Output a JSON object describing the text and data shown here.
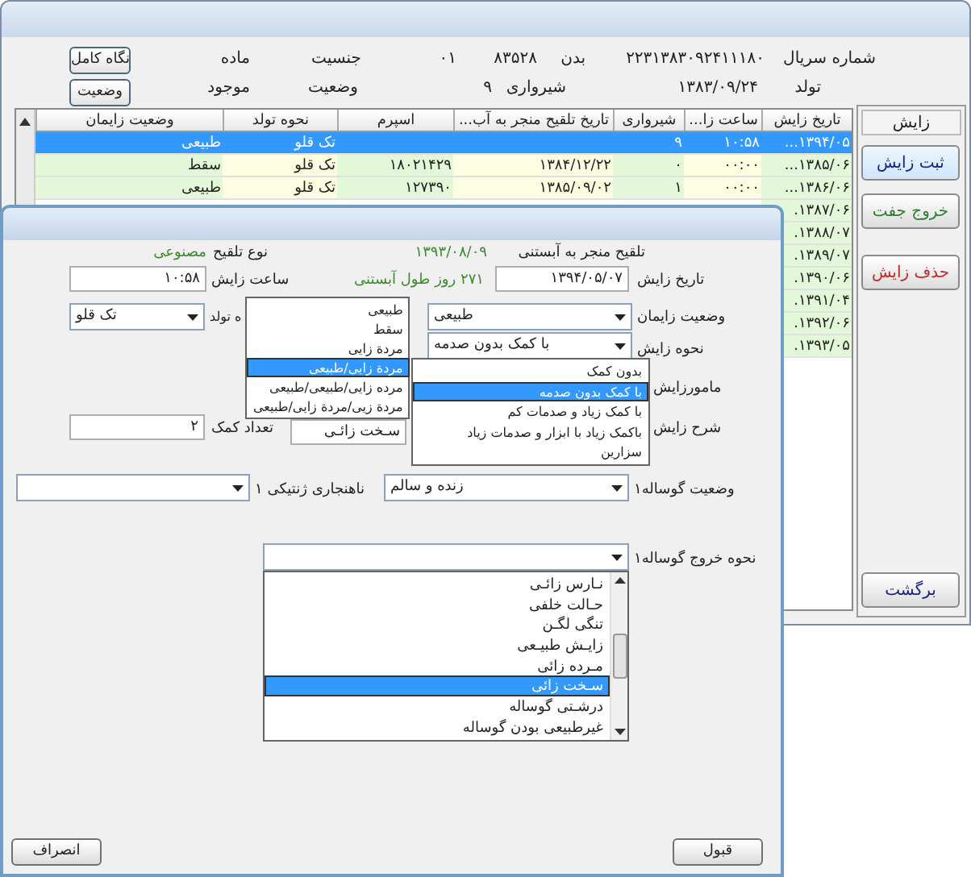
{
  "main_window": {
    "header": [
      {
        "label": "شماره سریال",
        "values": [
          "۲۲۳۱۳۸۳۰۹۲۴۱۱۱۸۰"
        ]
      },
      {
        "label": "بدن",
        "values": [
          "۸۳۵۲۸",
          "۰۱"
        ]
      },
      {
        "label": "جنسیت",
        "values": [
          "ماده"
        ]
      },
      {
        "label": "تولد",
        "values": [
          "۱۳۸۳/۰۹/۲۴"
        ]
      },
      {
        "label": "شیرواری",
        "values": [
          "۹"
        ]
      },
      {
        "label": "وضعیت",
        "values": [
          "موجود"
        ]
      }
    ],
    "header_buttons": [
      "نگاه کامل",
      "وضعیت"
    ],
    "table": {
      "columns": [
        "تاریخ زایش",
        "ساعت زا...",
        "شیرواری",
        "تاریخ تلقیح منجر به آب...",
        "اسپرم",
        "نحوه تولد",
        "وضعیت زایمان"
      ],
      "rows": [
        {
          "cells": [
            "۱۳۹۴/۰۵...",
            "۱۰:۵۸",
            "۹",
            "",
            "",
            "تک قلو",
            "طبیعی"
          ],
          "selected": true
        },
        {
          "cells": [
            "۱۳۸۵/۰۶...",
            "۰۰:۰۰",
            "۰",
            "۱۳۸۴/۱۲/۲۲",
            "۱۸۰۲۱۴۲۹",
            "تک قلو",
            "سقط"
          ],
          "selected": false
        },
        {
          "cells": [
            "۱۳۸۶/۰۶...",
            "۰۰:۰۰",
            "۱",
            "۱۳۸۵/۰۹/۰۲",
            "۱۲۷۳۹۰",
            "تک قلو",
            "طبیعی"
          ],
          "selected": false
        },
        {
          "cells": [
            "۱۳۸۷/۰۶."
          ],
          "selected": false
        },
        {
          "cells": [
            "۱۳۸۸/۰۷."
          ],
          "selected": false
        },
        {
          "cells": [
            "۱۳۸۹/۰۷."
          ],
          "selected": false
        },
        {
          "cells": [
            "۱۳۹۰/۰۶."
          ],
          "selected": false
        },
        {
          "cells": [
            "۱۳۹۱/۰۴."
          ],
          "selected": false
        },
        {
          "cells": [
            "۱۳۹۲/۰۶."
          ],
          "selected": false
        },
        {
          "cells": [
            "۱۳۹۳/۰۵."
          ],
          "selected": false
        }
      ]
    },
    "side_panel": {
      "title": "زایش",
      "buttons": [
        {
          "label": "ثبت زایش",
          "color": "#1a237e"
        },
        {
          "label": "خروج جفت",
          "color": "#2e7d32"
        },
        {
          "label": "حذف زایش",
          "color": "#c62828"
        },
        {
          "label": "برگشت",
          "color": "#1a237e"
        }
      ]
    }
  },
  "dialog": {
    "info": [
      {
        "kind": "label",
        "text": "تلقیح منجر به آبستنی"
      },
      {
        "kind": "value",
        "text": "۱۳۹۳/۰۸/۰۹"
      },
      {
        "kind": "label",
        "text": "نوع تلقیح"
      },
      {
        "kind": "value",
        "text": "مصنوعی"
      },
      {
        "kind": "value",
        "text": "۲۷۱ روز طول آبستنی"
      }
    ],
    "fields": [
      {
        "kind": "text",
        "label": "تاریخ زایش",
        "value": "۱۳۹۴/۰۵/۰۷"
      },
      {
        "kind": "text",
        "label": "ساعت زایش",
        "value": "۱۰:۵۸"
      },
      {
        "kind": "combo",
        "label": "وضعیت زایمان",
        "value": "طبیعی"
      },
      {
        "kind": "combo",
        "label": "ه تولد",
        "value": "تک قلو"
      },
      {
        "kind": "combo",
        "label": "نحوه زایش",
        "value": "با کمک بدون صدمه"
      },
      {
        "kind": "label",
        "label": "مامورزایش"
      },
      {
        "kind": "label",
        "label": "شرح زایش"
      },
      {
        "kind": "text",
        "value": "سـخت زائـی"
      },
      {
        "kind": "text",
        "label": "تعداد کمک",
        "value": "۲"
      },
      {
        "kind": "combo",
        "label": "وضعیت گوساله۱",
        "value": "زنده و سالم"
      },
      {
        "kind": "combo",
        "label": "ناهنجاری ژنتیکی ۱"
      },
      {
        "kind": "combo",
        "label": "نحوه خروج گوساله۱"
      }
    ],
    "open_lists": [
      {
        "items": [
          {
            "text": "طبیعی",
            "selected": false
          },
          {
            "text": "سقط",
            "selected": false
          },
          {
            "text": "مردة زایی",
            "selected": false
          },
          {
            "text": "مردة زایی/طبیعی",
            "selected": true
          },
          {
            "text": "مرده زایی/طبیعی/طبیعی",
            "selected": false
          },
          {
            "text": "مردة زیی/مردة زایی/طبیعی",
            "selected": false
          }
        ]
      },
      {
        "items": [
          {
            "text": "بدون کمک",
            "selected": false
          },
          {
            "text": "با کمک بدون صدمه",
            "selected": true
          },
          {
            "text": "با کمک زیاد و صدمات کم",
            "selected": false
          },
          {
            "text": "باکمک زیاد با ابزار و صدمات زیاد",
            "selected": false
          },
          {
            "text": "سزارین",
            "selected": false
          }
        ]
      },
      {
        "items": [
          {
            "text": "نـارس زائـی",
            "selected": false
          },
          {
            "text": "حـالت خلفی",
            "selected": false
          },
          {
            "text": "تنگی لگـن",
            "selected": false
          },
          {
            "text": "زایـش طبیـعی",
            "selected": false
          },
          {
            "text": "مـرده زائی",
            "selected": false
          },
          {
            "text": "سـخت زائی",
            "selected": true
          },
          {
            "text": "درشـتی گوساله",
            "selected": false
          },
          {
            "text": "غیرطبیعی بودن گوساله",
            "selected": false
          }
        ]
      }
    ],
    "buttons": [
      "قبول",
      "انصراف"
    ]
  }
}
